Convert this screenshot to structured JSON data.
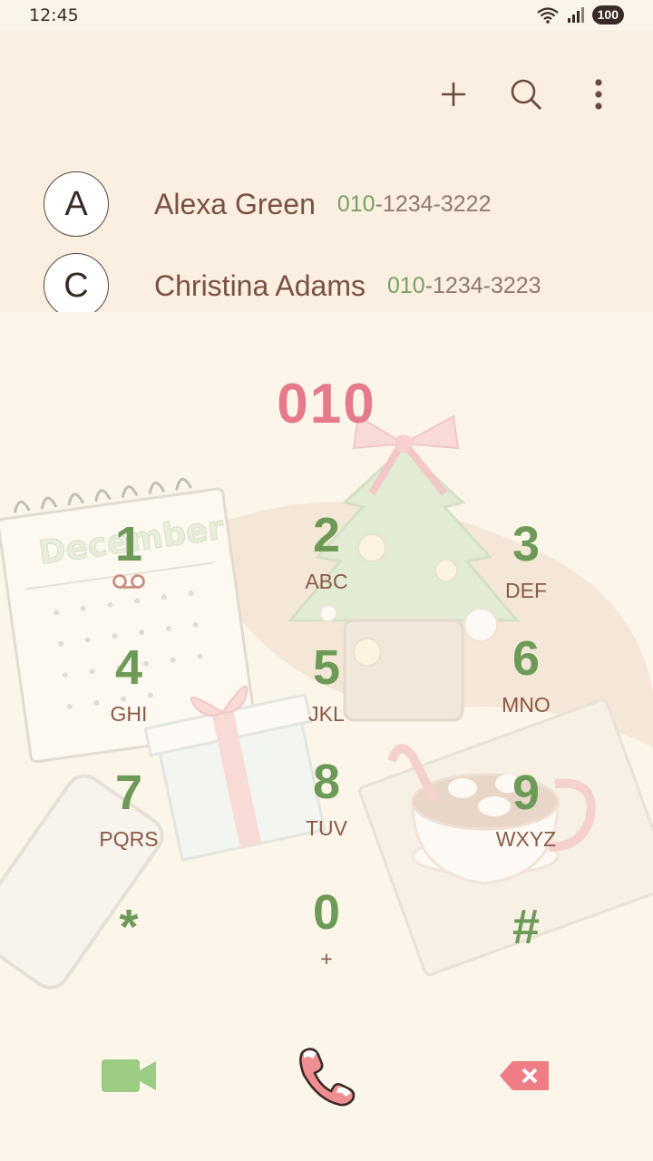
{
  "status": {
    "time": "12:45",
    "battery": "100"
  },
  "toolbar": {
    "add_icon": "plus-icon",
    "search_icon": "search-icon",
    "more_icon": "more-vertical-icon"
  },
  "contacts": [
    {
      "initial": "A",
      "name": "Alexa Green",
      "number_match": "010",
      "number_rest": "-1234-3222"
    },
    {
      "initial": "C",
      "name": "Christina Adams",
      "number_match": "010",
      "number_rest": "-1234-3223"
    }
  ],
  "dialed_number": "010",
  "keypad": [
    {
      "digit": "1",
      "letters": ""
    },
    {
      "digit": "2",
      "letters": "ABC"
    },
    {
      "digit": "3",
      "letters": "DEF"
    },
    {
      "digit": "4",
      "letters": "GHI"
    },
    {
      "digit": "5",
      "letters": "JKL"
    },
    {
      "digit": "6",
      "letters": "MNO"
    },
    {
      "digit": "7",
      "letters": "PQRS"
    },
    {
      "digit": "8",
      "letters": "TUV"
    },
    {
      "digit": "9",
      "letters": "WXYZ"
    },
    {
      "digit": "*",
      "letters": ""
    },
    {
      "digit": "0",
      "letters": "+"
    },
    {
      "digit": "#",
      "letters": ""
    }
  ],
  "decor_text": "December",
  "colors": {
    "accent_green": "#6e9a58",
    "accent_pink": "#e77a8a",
    "brown": "#8a5a48"
  }
}
